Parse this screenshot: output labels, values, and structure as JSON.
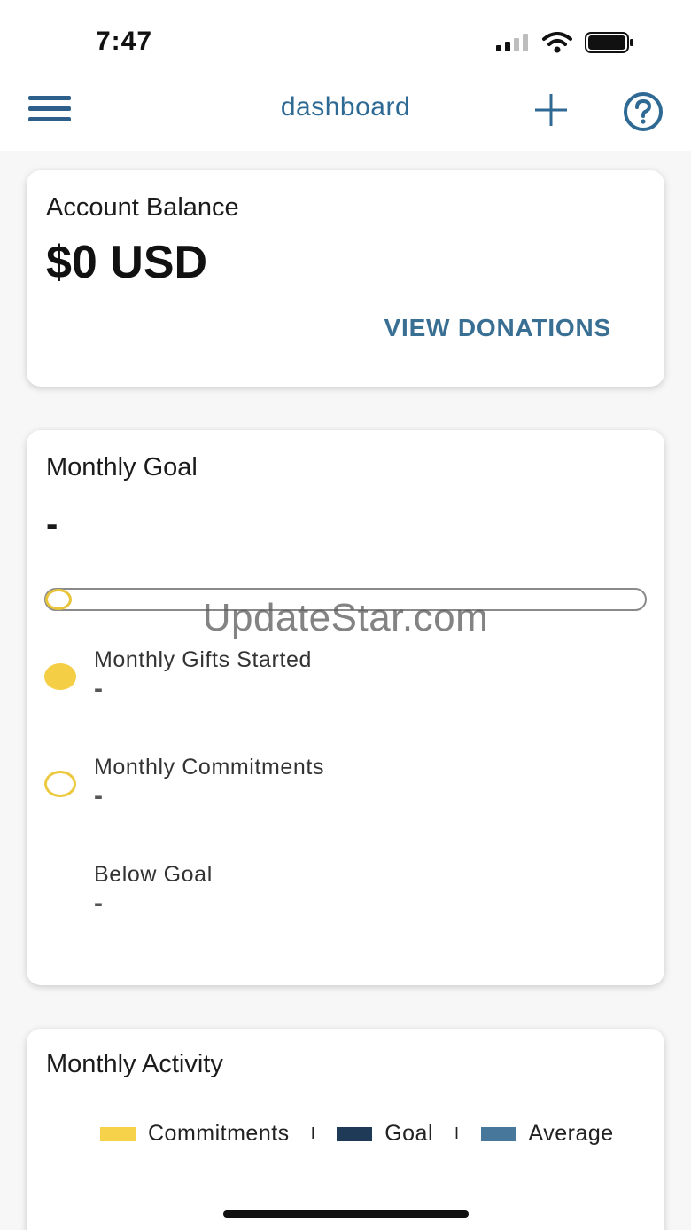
{
  "status_bar": {
    "time": "7:47"
  },
  "nav": {
    "title": "dashboard"
  },
  "account_balance": {
    "title": "Account Balance",
    "amount": "$0 USD",
    "view_donations": "VIEW DONATIONS"
  },
  "monthly_goal": {
    "title": "Monthly Goal",
    "value": "-",
    "progress": 0,
    "items": [
      {
        "label": "Monthly Gifts Started",
        "value": "-"
      },
      {
        "label": "Monthly Commitments",
        "value": "-"
      },
      {
        "label": "Below Goal",
        "value": "-"
      }
    ]
  },
  "monthly_activity": {
    "title": "Monthly Activity",
    "legend": [
      {
        "label": "Commitments",
        "color": "#f5d24a"
      },
      {
        "label": "Goal",
        "color": "#1e3a56"
      },
      {
        "label": "Average",
        "color": "#47789c"
      }
    ],
    "separator": "I"
  },
  "watermark": "UpdateStar.com",
  "colors": {
    "accent": "#2f6a95",
    "gold": "#f4cf45"
  }
}
